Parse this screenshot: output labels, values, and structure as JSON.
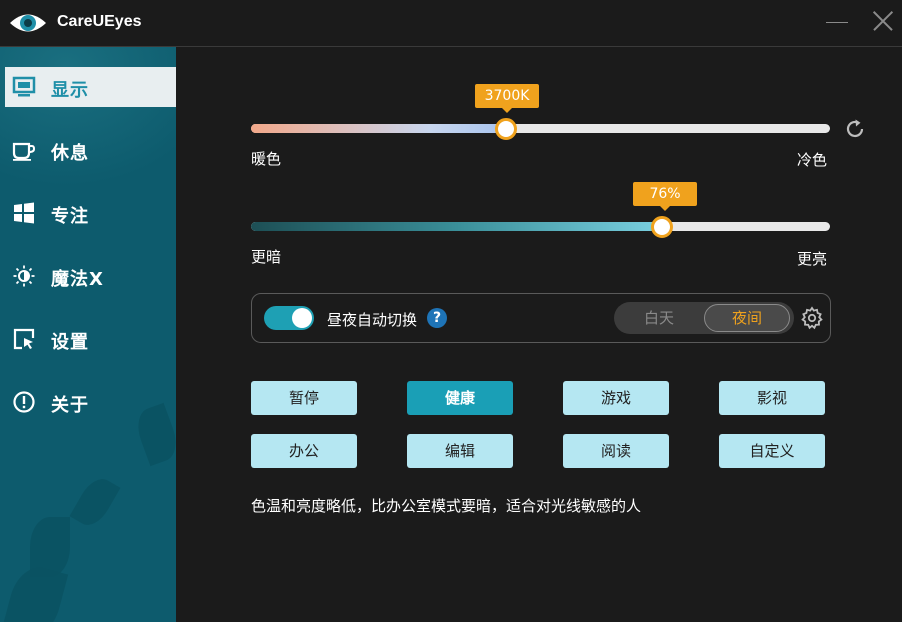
{
  "app": {
    "title": "CareUEyes"
  },
  "sidebar": {
    "items": [
      {
        "label": "显示",
        "icon": "monitor-icon",
        "active": true
      },
      {
        "label": "休息",
        "icon": "coffee-cup-icon"
      },
      {
        "label": "专注",
        "icon": "windows-icon"
      },
      {
        "label": "魔法X",
        "icon": "sun-moon-icon"
      },
      {
        "label": "设置",
        "icon": "settings-cursor-icon"
      },
      {
        "label": "关于",
        "icon": "info-exclamation-icon"
      }
    ]
  },
  "temperature": {
    "value_label": "3700K",
    "value_fraction": 0.44,
    "left_label": "暖色",
    "right_label": "冷色"
  },
  "brightness": {
    "value_label": "76%",
    "value_fraction": 0.71,
    "left_label": "更暗",
    "right_label": "更亮"
  },
  "auto_switch": {
    "label": "昼夜自动切换",
    "enabled": true,
    "help": "?",
    "day_label": "白天",
    "night_label": "夜间",
    "selected": "夜间"
  },
  "modes": [
    {
      "label": "暂停"
    },
    {
      "label": "健康",
      "active": true
    },
    {
      "label": "游戏"
    },
    {
      "label": "影视"
    },
    {
      "label": "办公"
    },
    {
      "label": "编辑"
    },
    {
      "label": "阅读"
    },
    {
      "label": "自定义"
    }
  ],
  "description": "色温和亮度略低，比办公室模式要暗，适合对光线敏感的人",
  "colors": {
    "accent": "#f0a21d",
    "sidebar": "#0d5b6d",
    "active_mode": "#1a9fb6",
    "mode_button": "#b5e7f2"
  }
}
